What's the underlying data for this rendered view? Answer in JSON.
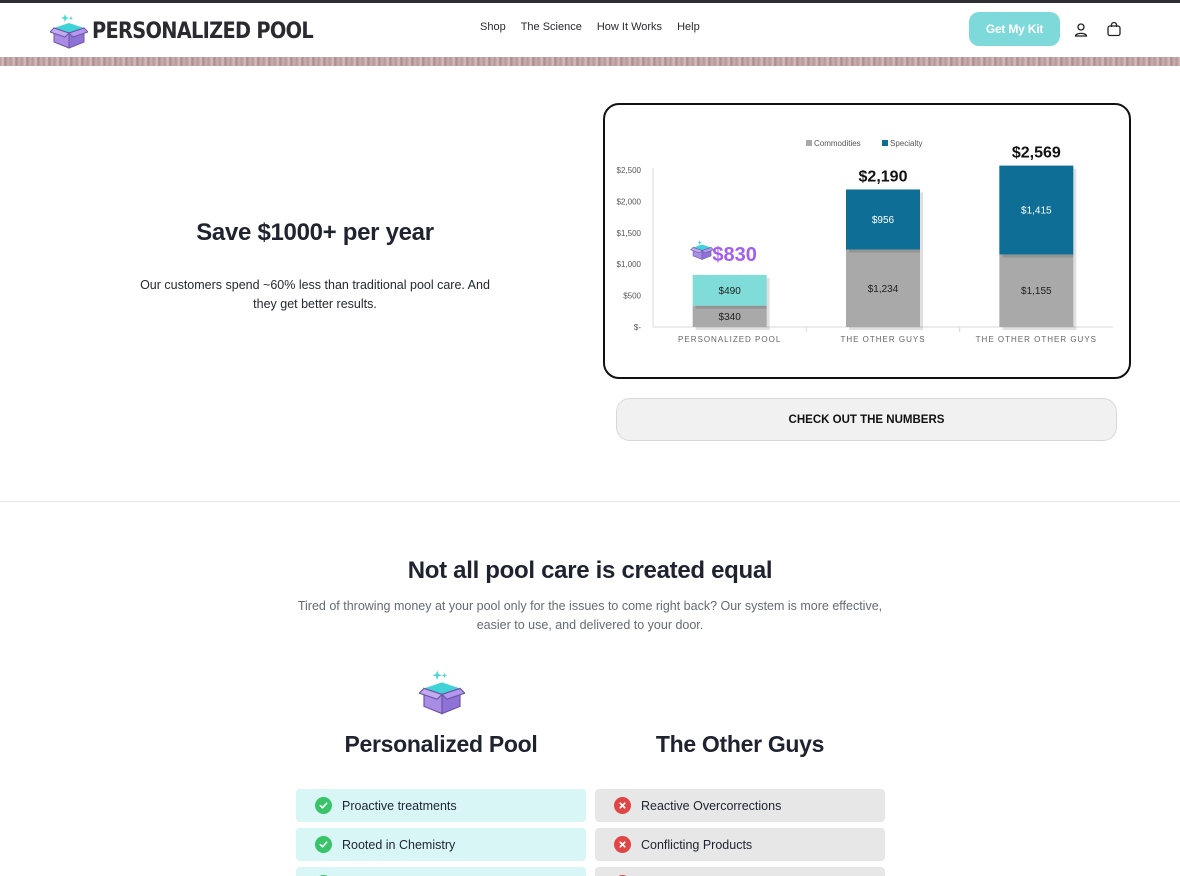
{
  "header": {
    "brand": "PERSONALIZED POOL",
    "nav": [
      "Shop",
      "The Science",
      "How It Works",
      "Help"
    ],
    "cta_label": "Get My Kit",
    "icons": [
      "account-icon",
      "cart-icon"
    ]
  },
  "savings": {
    "title": "Save $1000+ per year",
    "subtitle": "Our customers spend ~60% less than traditional pool care. And they get better results.",
    "button_label": "CHECK OUT THE NUMBERS"
  },
  "chart_data": {
    "type": "bar",
    "stacked": true,
    "legend_position": "top",
    "categories": [
      "PERSONALIZED POOL",
      "THE OTHER GUYS",
      "THE OTHER OTHER GUYS"
    ],
    "series": [
      {
        "name": "Commodities",
        "values": [
          340,
          1234,
          1155
        ],
        "labels": [
          "$340",
          "$1,234",
          "$1,155"
        ],
        "colors": [
          "#a9a9a9",
          "#a9a9a9",
          "#a9a9a9"
        ]
      },
      {
        "name": "Specialty",
        "values": [
          490,
          956,
          1415
        ],
        "labels": [
          "$490",
          "$956",
          "$1,415"
        ],
        "colors": [
          "#7fdcd8",
          "#0f6e96",
          "#0f6e96"
        ]
      }
    ],
    "totals": [
      "$830",
      "$2,190",
      "$2,569"
    ],
    "y_ticks": [
      0,
      500,
      1000,
      1500,
      2000,
      2500
    ],
    "y_tick_labels": [
      "$-",
      "$500",
      "$1,000",
      "$1,500",
      "$2,000",
      "$2,500"
    ],
    "ylim": [
      0,
      2500
    ],
    "grid": false,
    "colors": {
      "commodities": "#a9a9a9",
      "specialty": "#0f6e96",
      "personalized_specialty": "#7fdcd8",
      "personalized_total": "#a35ef0"
    }
  },
  "comparison": {
    "title": "Not all pool care is created equal",
    "subtitle": "Tired of throwing money at your pool only for the issues to come right back? Our system is more effective, easier to use, and delivered to your door.",
    "left_heading": "Personalized Pool",
    "right_heading": "The Other Guys",
    "left_items": [
      "Proactive treatments",
      "Rooted in Chemistry"
    ],
    "right_items": [
      "Reactive Overcorrections",
      "Conflicting Products"
    ]
  },
  "colors": {
    "accent": "#7ed9db",
    "good": "#39c46a",
    "bad": "#e04646",
    "left_row": "#d9f6f7",
    "right_row": "#e7e7e7"
  }
}
